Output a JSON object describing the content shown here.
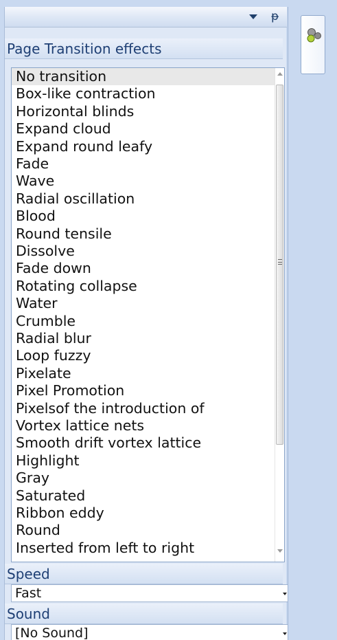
{
  "panel": {
    "effects_label": "Page Transition effects",
    "transitions": [
      "No transition",
      "Box-like contraction",
      "Horizontal blinds",
      "Expand cloud",
      "Expand round leafy",
      "Fade",
      "Wave",
      "Radial oscillation",
      "Blood",
      "Round tensile",
      "Dissolve",
      "Fade down",
      "Rotating collapse",
      "Water",
      "Crumble",
      "Radial blur",
      "Loop fuzzy",
      "Pixelate",
      "Pixel Promotion",
      "Pixelsof the introduction of",
      "Vortex lattice nets",
      "Smooth drift vortex lattice",
      "Highlight",
      "Gray",
      "Saturated",
      "Ribbon eddy",
      "Round",
      "Inserted from left to right"
    ],
    "selected_index": 0,
    "speed_label": "Speed",
    "speed_value": "Fast",
    "sound_label": "Sound",
    "sound_value": "[No Sound]"
  },
  "side_tab": {
    "icon": "transition-effect-icon"
  },
  "colors": {
    "panel_bg": "#dfe8f6",
    "header_text": "#1e3f74",
    "selected_item_bg": "#e8e8e8",
    "app_bg": "#c9d9f0"
  }
}
